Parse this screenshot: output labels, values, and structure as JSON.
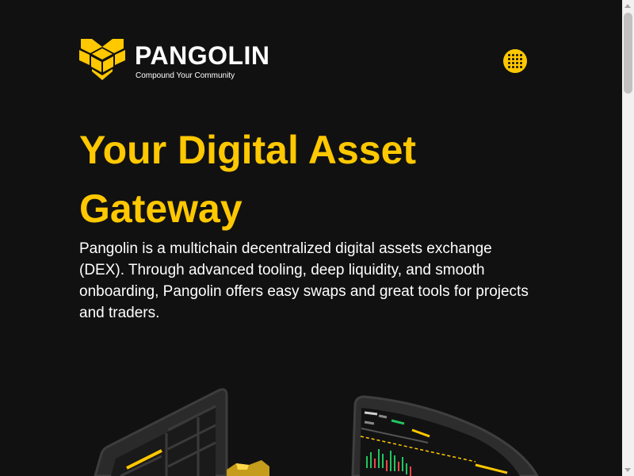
{
  "header": {
    "brand_name": "PANGOLIN",
    "tagline": "Compound Your Community",
    "logo_icon": "pangolin-logo-icon",
    "menu_icon": "grid-menu-icon"
  },
  "hero": {
    "title": "Your Digital Asset Gateway",
    "description": "Pangolin is a multichain decentralized digital assets exchange (DEX). Through advanced tooling, deep liquidity, and smooth onboarding, Pangolin offers easy swaps and great tools for projects and traders."
  },
  "colors": {
    "background": "#111112",
    "accent": "#ffc800",
    "text": "#ffffff"
  }
}
